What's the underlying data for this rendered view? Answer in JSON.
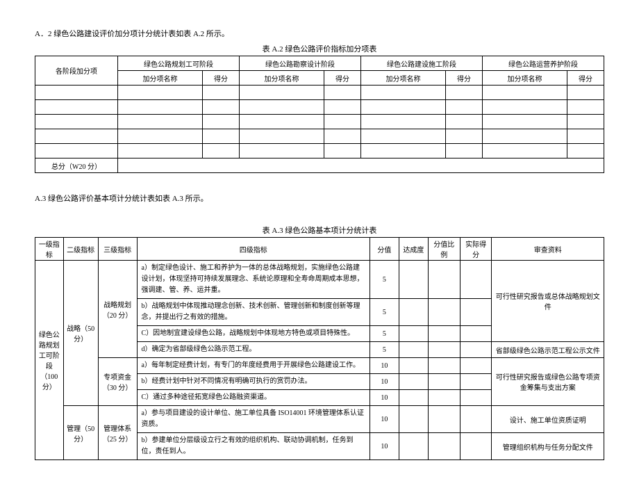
{
  "a2": {
    "intro": "A．2 绿色公路建设评价加分项计分统计表如表 A.2 所示。",
    "caption": "表 A.2 绿色公路评价指标加分项表",
    "headerStage": "各阶段加分项",
    "stages": [
      "绿色公路规划工可阶段",
      "绿色公路勘察设计阶段",
      "绿色公路建设施工阶段",
      "绿色公路运营养护阶段"
    ],
    "subName": "加分项名称",
    "subScore": "得分",
    "totalLabel": "总分（W20 分）"
  },
  "a3": {
    "intro": "A.3 绿色公路评价基本项计分统计表如表 A.3 所示。",
    "caption": "表 A.3 绿色公路基本项计分统计表",
    "headers": {
      "l1": "一级指标",
      "l2": "二级指标",
      "l3": "三级指标",
      "l4": "四级指标",
      "score": "分值",
      "reach": "达成度",
      "ratio": "分值比例",
      "actual": "实际得分",
      "material": "审查资料"
    },
    "level1": "绿色公路规划工可阶段（100 分）",
    "groups": [
      {
        "l2": "战略（50 分）",
        "l3a": "战略规划（20 分）",
        "rows_a": [
          {
            "t": "a）制定绿色设计、施工和养护为一体的总体战略规划，实施绿色公路建设计划，体现坚持可持续发展理念、系统论原理和全寿命周期成本思想，强调建、管、养、运并重。",
            "s": "5"
          },
          {
            "t": "b）战略规划中体现推动理念创新、技术创新、管理创新和制度创新等理念，并提出行之有效的措施。",
            "s": "5"
          },
          {
            "t": "C）因地制宜建设绿色公路，战略规划中体现地方特色或项目特殊性。",
            "s": "5"
          },
          {
            "t": "d）确定为省部级绿色公路示范工程。",
            "s": "5"
          }
        ],
        "mat_a1": "可行性研究报告或总体战略规划文件",
        "mat_a2": "省部级绿色公路示范工程公示文件",
        "l3b": "专项资金（30 分）",
        "rows_b": [
          {
            "t": "a）每年制定经费计划，有专门的年度经费用于开展绿色公路建设工作。",
            "s": "10"
          },
          {
            "t": "b）经费计划中针对不同情况有明确可执行的赏罚办法。",
            "s": "10"
          },
          {
            "t": "C）通过多种途径拓宽绿色公路融资渠道。",
            "s": "10"
          }
        ],
        "mat_b": "可行性研究报告或绿色公路专项资金筹集与支出方案"
      },
      {
        "l2": "管理（50 分）",
        "l3": "管理体系（25 分）",
        "rows": [
          {
            "t": "a）参与项目建设的设计单位、施工单位具备 ISO14001 环境管理体系认证资质。",
            "s": "10",
            "m": "设计、施工单位资质证明"
          },
          {
            "t": "b）参建单位分层级设立行之有效的组织机构、联动协调机制，任务到位，责任到人。",
            "s": "10",
            "m": "管理组织机构与任务分配文件"
          }
        ]
      }
    ]
  }
}
